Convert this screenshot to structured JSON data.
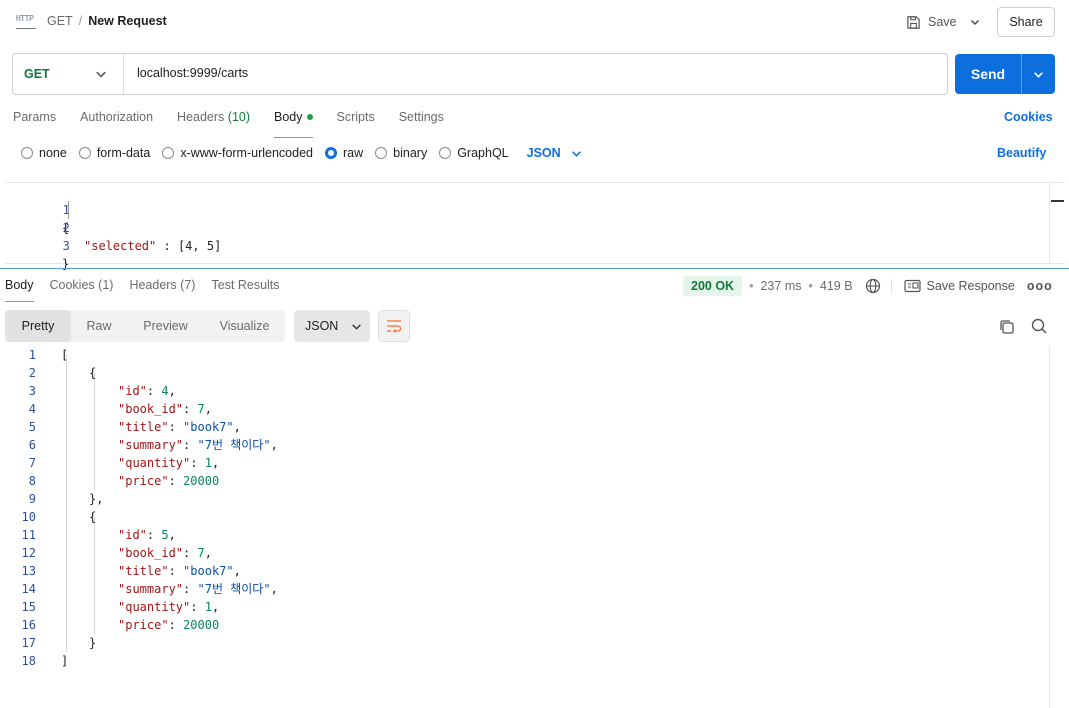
{
  "header": {
    "icon_label": "HTTP",
    "method": "GET",
    "separator": "/",
    "request_name": "New Request",
    "save_label": "Save",
    "share_label": "Share"
  },
  "request": {
    "method": "GET",
    "url": "localhost:9999/carts",
    "send_label": "Send"
  },
  "request_tabs": [
    {
      "label": "Params"
    },
    {
      "label": "Authorization"
    },
    {
      "label": "Headers",
      "count": "(10)"
    },
    {
      "label": "Body"
    },
    {
      "label": "Scripts"
    },
    {
      "label": "Settings"
    }
  ],
  "cookies_label": "Cookies",
  "body_types": [
    {
      "label": "none"
    },
    {
      "label": "form-data"
    },
    {
      "label": "x-www-form-urlencoded"
    },
    {
      "label": "raw"
    },
    {
      "label": "binary"
    },
    {
      "label": "GraphQL"
    }
  ],
  "selected_body_type": "raw",
  "body_format": "JSON",
  "beautify_label": "Beautify",
  "request_body_lines": [
    {
      "n": "1",
      "text": "{"
    },
    {
      "n": "2",
      "text": "\"selected\" : [4, 5]"
    },
    {
      "n": "3",
      "text": "}"
    }
  ],
  "response_tabs": [
    {
      "label": "Body"
    },
    {
      "label": "Cookies",
      "count": "(1)"
    },
    {
      "label": "Headers",
      "count": "(7)"
    },
    {
      "label": "Test Results"
    }
  ],
  "response_meta": {
    "status": "200 OK",
    "time": "237 ms",
    "size": "419 B",
    "save_response_label": "Save Response",
    "more": "ooo"
  },
  "view_modes": [
    "Pretty",
    "Raw",
    "Preview",
    "Visualize"
  ],
  "response_format": "JSON",
  "response_lines": [
    {
      "n": "1",
      "text": "["
    },
    {
      "n": "2",
      "text": "{"
    },
    {
      "n": "3",
      "text": "\"id\": 4,"
    },
    {
      "n": "4",
      "text": "\"book_id\": 7,"
    },
    {
      "n": "5",
      "text": "\"title\": \"book7\","
    },
    {
      "n": "6",
      "text": "\"summary\": \"7번 책이다\","
    },
    {
      "n": "7",
      "text": "\"quantity\": 1,"
    },
    {
      "n": "8",
      "text": "\"price\": 20000"
    },
    {
      "n": "9",
      "text": "},"
    },
    {
      "n": "10",
      "text": "{"
    },
    {
      "n": "11",
      "text": "\"id\": 5,"
    },
    {
      "n": "12",
      "text": "\"book_id\": 7,"
    },
    {
      "n": "13",
      "text": "\"title\": \"book7\","
    },
    {
      "n": "14",
      "text": "\"summary\": \"7번 책이다\","
    },
    {
      "n": "15",
      "text": "\"quantity\": 1,"
    },
    {
      "n": "16",
      "text": "\"price\": 20000"
    },
    {
      "n": "17",
      "text": "}"
    },
    {
      "n": "18",
      "text": "]"
    }
  ],
  "colors": {
    "accent": "#0d6fde",
    "method_get": "#0f7a3a",
    "active_tab_underline": "#ff6c37",
    "status_ok_bg": "#e4f5ea"
  }
}
